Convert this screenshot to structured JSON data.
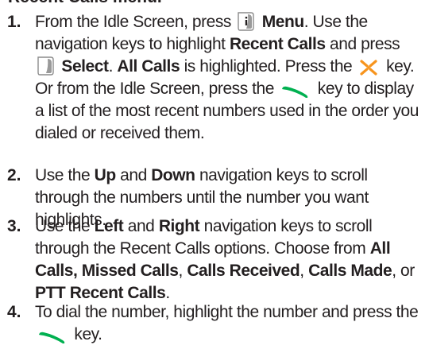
{
  "heading_partial": "Recent Calls menu.",
  "steps": [
    {
      "number": "1.",
      "parts": [
        "From the Idle Screen, press",
        "Menu",
        ". Use the navigation keys to highlight",
        "Recent Calls",
        "and press",
        "Select",
        ".",
        "All Calls",
        "is highlighted. Press the",
        "key. Or from the Idle Screen, press the",
        "key to display a list of the most recent numbers used in the order you dialed or received them."
      ]
    },
    {
      "number": "2.",
      "parts": [
        "Use the",
        "Up",
        "and",
        "Down",
        "navigation keys to scroll through the numbers until the number you want highlights."
      ]
    },
    {
      "number": "3.",
      "parts": [
        "Use the",
        "Left",
        "and",
        "Right",
        "navigation keys to scroll through the Recent Calls options. Choose from",
        "All Calls, Missed Calls",
        ",",
        "Calls Received",
        ",",
        "Calls Made",
        ", or",
        "PTT Recent Calls",
        "."
      ]
    },
    {
      "number": "4.",
      "parts": [
        "To dial the number, highlight the number and press the",
        "key."
      ]
    }
  ],
  "icons": {
    "menu_key": "softkey-menu-icon",
    "select_key": "softkey-select-icon",
    "cross_key": "navigation-cross-key-icon",
    "send_key": "send-key-icon"
  },
  "colors": {
    "text": "#231f20",
    "send_key_green": "#00b050",
    "cross_key_orange": "#f7941d",
    "softkey_gray": "#9a9a9a"
  }
}
